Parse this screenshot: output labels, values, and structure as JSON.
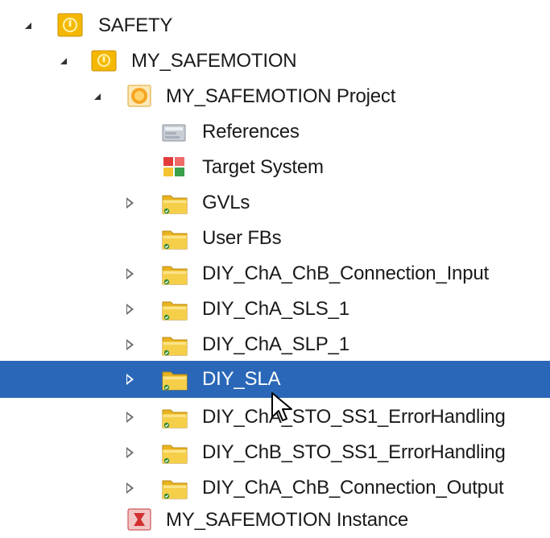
{
  "tree": {
    "safety": {
      "label": "SAFETY",
      "expanded": true,
      "icon": "safety-icon"
    },
    "safemotion": {
      "label": "MY_SAFEMOTION",
      "expanded": true,
      "icon": "safety-group-icon"
    },
    "project": {
      "label": "MY_SAFEMOTION Project",
      "expanded": true,
      "icon": "project-icon"
    },
    "references": {
      "label": "References",
      "icon": "references-icon"
    },
    "target_system": {
      "label": "Target System",
      "icon": "target-system-icon"
    },
    "gvls": {
      "label": "GVLs",
      "icon": "folder-icon"
    },
    "user_fbs": {
      "label": "User FBs",
      "icon": "folder-icon"
    },
    "conn_input": {
      "label": "DIY_ChA_ChB_Connection_Input",
      "icon": "folder-icon"
    },
    "cha_sls": {
      "label": "DIY_ChA_SLS_1",
      "icon": "folder-icon"
    },
    "cha_slp": {
      "label": "DIY_ChA_SLP_1",
      "icon": "folder-icon"
    },
    "sla": {
      "label": "DIY_SLA",
      "icon": "folder-icon",
      "selected": true
    },
    "cha_sto": {
      "label": "DIY_ChA_STO_SS1_ErrorHandling",
      "icon": "folder-icon"
    },
    "chb_sto": {
      "label": "DIY_ChB_STO_SS1_ErrorHandling",
      "icon": "folder-icon"
    },
    "conn_output": {
      "label": "DIY_ChA_ChB_Connection_Output",
      "icon": "folder-icon"
    },
    "instance": {
      "label": "MY_SAFEMOTION Instance",
      "icon": "instance-icon"
    }
  },
  "colors": {
    "selection": "#2a67b8",
    "folder": "#f2c233",
    "safety": "#f5b800"
  }
}
